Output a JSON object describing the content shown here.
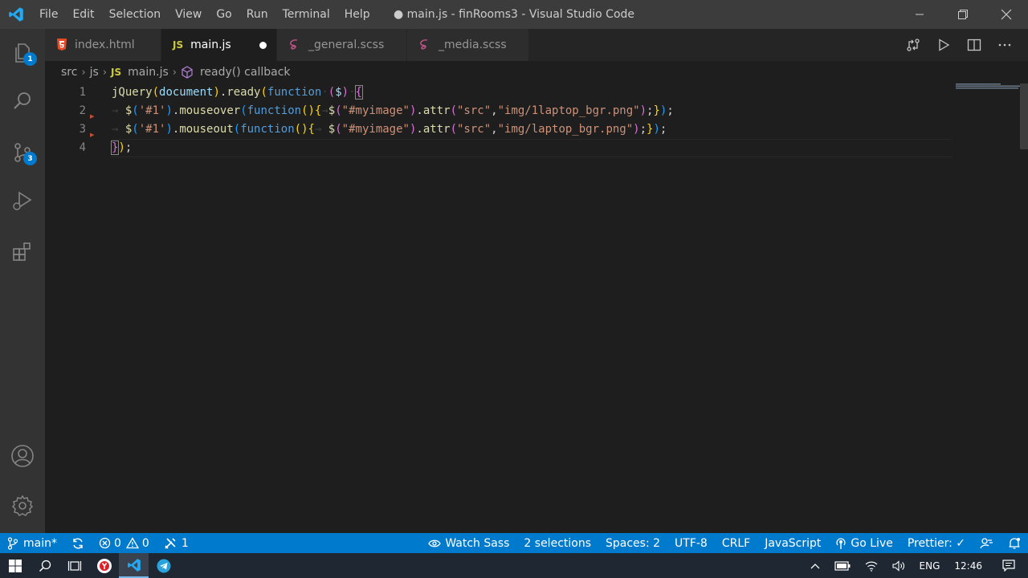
{
  "window": {
    "title": "● main.js - finRooms3 - Visual Studio Code",
    "menu": [
      "File",
      "Edit",
      "Selection",
      "View",
      "Go",
      "Run",
      "Terminal",
      "Help"
    ]
  },
  "activity_bar": {
    "items": [
      {
        "name": "explorer",
        "icon": "files-icon",
        "badge": "1"
      },
      {
        "name": "search",
        "icon": "search-icon"
      },
      {
        "name": "source-control",
        "icon": "source-control-icon",
        "badge": "3"
      },
      {
        "name": "run-debug",
        "icon": "run-debug-icon"
      },
      {
        "name": "extensions",
        "icon": "extensions-icon"
      }
    ],
    "bottom": [
      {
        "name": "accounts",
        "icon": "account-icon"
      },
      {
        "name": "manage",
        "icon": "gear-icon"
      }
    ]
  },
  "tabs": [
    {
      "label": "index.html",
      "icon": "html5-icon",
      "active": false
    },
    {
      "label": "main.js",
      "icon": "js-icon",
      "icon_text": "JS",
      "active": true,
      "dirty": true
    },
    {
      "label": "_general.scss",
      "icon": "sass-icon",
      "active": false
    },
    {
      "label": "_media.scss",
      "icon": "sass-icon",
      "active": false
    }
  ],
  "breadcrumbs": {
    "items": [
      "src",
      "js",
      "main.js",
      "ready() callback"
    ],
    "js_badge": "JS"
  },
  "editor": {
    "line_numbers": [
      "1",
      "2",
      "3",
      "4"
    ],
    "lines": [
      [
        {
          "t": "jQuery",
          "c": "c-fn"
        },
        {
          "t": "(",
          "c": "c-p1"
        },
        {
          "t": "document",
          "c": "c-var"
        },
        {
          "t": ")",
          "c": "c-p1"
        },
        {
          "t": ".",
          "c": "c-def"
        },
        {
          "t": "ready",
          "c": "c-fn"
        },
        {
          "t": "(",
          "c": "c-p1"
        },
        {
          "t": "function",
          "c": "c-kw"
        },
        {
          "t": "·",
          "c": "c-ws"
        },
        {
          "t": "(",
          "c": "c-p2"
        },
        {
          "t": "$",
          "c": "c-var"
        },
        {
          "t": ")",
          "c": "c-p2"
        },
        {
          "t": "·",
          "c": "c-ws"
        },
        {
          "t": "{",
          "c": "c-p2"
        }
      ],
      [
        {
          "t": "→ ",
          "c": "c-ws"
        },
        {
          "t": "$",
          "c": "c-fn"
        },
        {
          "t": "(",
          "c": "c-p3"
        },
        {
          "t": "'#1'",
          "c": "c-str"
        },
        {
          "t": ")",
          "c": "c-p3"
        },
        {
          "t": ".",
          "c": "c-def"
        },
        {
          "t": "mouseover",
          "c": "c-fn"
        },
        {
          "t": "(",
          "c": "c-p3"
        },
        {
          "t": "function",
          "c": "c-kw"
        },
        {
          "t": "()",
          "c": "c-p1"
        },
        {
          "t": "{",
          "c": "c-p1"
        },
        {
          "t": "→",
          "c": "c-ws"
        },
        {
          "t": "$",
          "c": "c-fn"
        },
        {
          "t": "(",
          "c": "c-p2"
        },
        {
          "t": "\"#myimage\"",
          "c": "c-str"
        },
        {
          "t": ")",
          "c": "c-p2"
        },
        {
          "t": ".",
          "c": "c-def"
        },
        {
          "t": "attr",
          "c": "c-fn"
        },
        {
          "t": "(",
          "c": "c-p2"
        },
        {
          "t": "\"src\"",
          "c": "c-str"
        },
        {
          "t": ",",
          "c": "c-def"
        },
        {
          "t": "\"img/1laptop_bgr.png\"",
          "c": "c-str"
        },
        {
          "t": ")",
          "c": "c-p2"
        },
        {
          "t": ";",
          "c": "c-def"
        },
        {
          "t": "}",
          "c": "c-p1"
        },
        {
          "t": ")",
          "c": "c-p3"
        },
        {
          "t": ";",
          "c": "c-def"
        }
      ],
      [
        {
          "t": "→ ",
          "c": "c-ws"
        },
        {
          "t": "$",
          "c": "c-fn"
        },
        {
          "t": "(",
          "c": "c-p3"
        },
        {
          "t": "'#1'",
          "c": "c-str"
        },
        {
          "t": ")",
          "c": "c-p3"
        },
        {
          "t": ".",
          "c": "c-def"
        },
        {
          "t": "mouseout",
          "c": "c-fn"
        },
        {
          "t": "(",
          "c": "c-p3"
        },
        {
          "t": "function",
          "c": "c-kw"
        },
        {
          "t": "()",
          "c": "c-p1"
        },
        {
          "t": "{",
          "c": "c-p1"
        },
        {
          "t": "→ ",
          "c": "c-ws"
        },
        {
          "t": "$",
          "c": "c-fn"
        },
        {
          "t": "(",
          "c": "c-p2"
        },
        {
          "t": "\"#myimage\"",
          "c": "c-str"
        },
        {
          "t": ")",
          "c": "c-p2"
        },
        {
          "t": ".",
          "c": "c-def"
        },
        {
          "t": "attr",
          "c": "c-fn"
        },
        {
          "t": "(",
          "c": "c-p2"
        },
        {
          "t": "\"src\"",
          "c": "c-str"
        },
        {
          "t": ",",
          "c": "c-def"
        },
        {
          "t": "\"img/laptop_bgr.png\"",
          "c": "c-str"
        },
        {
          "t": ")",
          "c": "c-p2"
        },
        {
          "t": ";",
          "c": "c-def"
        },
        {
          "t": "}",
          "c": "c-p1"
        },
        {
          "t": ")",
          "c": "c-p3"
        },
        {
          "t": ";",
          "c": "c-def"
        }
      ],
      [
        {
          "t": "}",
          "c": "c-p2"
        },
        {
          "t": ")",
          "c": "c-p1"
        },
        {
          "t": ";",
          "c": "c-def"
        }
      ]
    ]
  },
  "status_bar": {
    "branch": "main*",
    "errors": "0",
    "warnings": "0",
    "live_share": "1",
    "watch_sass": "Watch Sass",
    "selections": "2 selections",
    "spaces": "Spaces: 2",
    "encoding": "UTF-8",
    "eol": "CRLF",
    "language": "JavaScript",
    "go_live": "Go Live",
    "prettier": "Prettier: ✓"
  },
  "taskbar": {
    "lang": "ENG",
    "time": "12:46"
  },
  "colors": {
    "accent": "#007acc",
    "titlebar": "#3c3c3c",
    "activitybar": "#333333",
    "editor_bg": "#1e1e1e"
  }
}
